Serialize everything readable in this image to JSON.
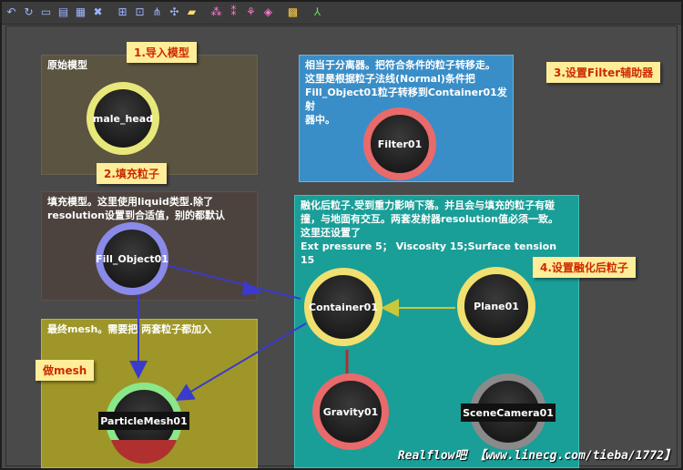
{
  "toolbar": {
    "icons": [
      "undo-icon",
      "redo-icon",
      "folder-icon",
      "scene-icon",
      "grid-icon",
      "delete-icon",
      "zoom-icon",
      "zoom-region-icon",
      "link-icon",
      "note-icon",
      "emitter-icon",
      "daemon-icon",
      "object-icon",
      "mesh-icon",
      "camera-icon"
    ]
  },
  "boxes": {
    "original_model": "原始模型",
    "filter_desc": "相当于分离器。把符合条件的粒子转移走。\n这里是根据粒子法线(Normal)条件把\nFill_Object01粒子转移到Container01发射\n器中。",
    "fill_desc": "填充模型。这里使用liquid类型.除了\nresolution设置到合适值，别的都默认",
    "melt_desc": "融化后粒子.受到重力影响下落。并且会与填充的粒子有碰\n撞，与地面有交互。两套发射器resolution值必须一致。\n这里还设置了\nExt pressure  5； Viscosity 15;Surface tension 15",
    "mesh_desc": "最终mesh。需要把   两套粒子都加入"
  },
  "notes": {
    "import": "1.导入模型",
    "fill": "2.填充粒子",
    "filter": "3.设置Filter辅助器",
    "melt": "4.设置融化后粒子",
    "mesh": "做mesh"
  },
  "nodes": {
    "male_head": "male_head",
    "filter": "Filter01",
    "fill": "Fill_Object01",
    "container": "Container01",
    "plane": "Plane01",
    "gravity": "Gravity01",
    "mesh": "ParticleMesh01",
    "camera": "SceneCamera01"
  },
  "colors": {
    "male_head_ring": "#e8e87a",
    "filter_ring": "#e86a6a",
    "fill_ring": "#8a8ae8",
    "container_ring": "#f0e070",
    "plane_ring": "#f0e070",
    "gravity_ring": "#e86a6a",
    "mesh_ring": "#8ae88a",
    "camera_ring": "#8a8a8a",
    "link_blue": "#3a3acc",
    "link_yellow": "#c8c83a",
    "link_red": "#b03030"
  },
  "watermark": "Realflow吧   【www.linecg.com/tieba/1772】"
}
